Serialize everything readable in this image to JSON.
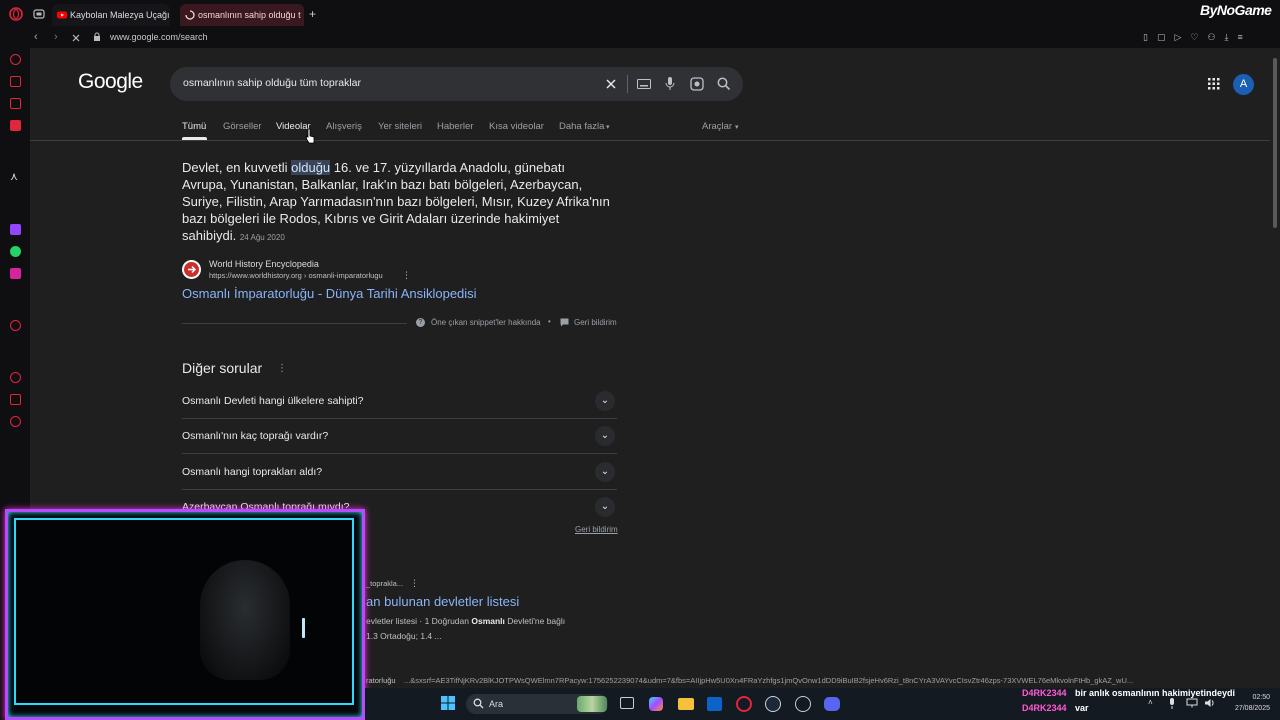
{
  "browser": {
    "tabs": [
      {
        "label": "Kaybolan Malezya Uçağı",
        "active": false
      },
      {
        "label": "osmanlının sahip olduğu t",
        "active": true
      }
    ],
    "new_tab_symbol": "+",
    "address": "www.google.com/search",
    "brand": "ByNoGame"
  },
  "google": {
    "logo": "Google",
    "query": "osmanlının sahip olduğu tüm topraklar",
    "account_initial": "A",
    "tabs": [
      "Tümü",
      "Görseller",
      "Videolar",
      "Alışveriş",
      "Yer siteleri",
      "Haberler",
      "Kısa videolar",
      "Daha fazla"
    ],
    "tools": "Araçlar",
    "featured": {
      "pre": "Devlet, en kuvvetli ",
      "highlight": "olduğu",
      "post": " 16. ve 17. yüzyıllarda Anadolu, günebatı Avrupa, Yunanistan, Balkanlar, Irak'ın bazı batı bölgeleri, Azerbaycan, Suriye, Filistin, Arap Yarımadasın'nın bazı bölgeleri, Mısır, Kuzey Afrika'nın bazı bölgeleri ile Rodos, Kıbrıs ve Girit Adaları üzerinde hakimiyet sahibiydi.",
      "date": "24 Ağu 2020",
      "source_name": "World History Encyclopedia",
      "source_url": "https://www.worldhistory.org › osmanli-imparatorlugu",
      "link": "Osmanlı İmparatorluğu - Dünya Tarihi Ansiklopedisi",
      "about": "Öne çıkan snippet'ler hakkında",
      "feedback": "Geri bildirim"
    },
    "paa": {
      "title": "Diğer sorular",
      "questions": [
        "Osmanlı Devleti hangi ülkelere sahipti?",
        "Osmanlı'nın kaç toprağı vardır?",
        "Osmanlı hangi toprakları aldı?",
        "Azerbaycan Osmanlı toprağı mıydı?"
      ],
      "feedback": "Geri bildirim"
    },
    "result2": {
      "crumb": "_toprakla...",
      "link": "an bulunan devletler listesi",
      "desc_pre": "evletler listesi · 1 Doğrudan ",
      "desc_bold": "Osmanlı",
      "desc_post": " Devleti'ne bağlı",
      "desc_line2": "1.3 Ortadoğu; 1.4 ...",
      "crumb2": "ratorluğu"
    },
    "status_url": "...&sxsrf=AE3TifNjKRv2BlKJOTPWsQWElmn7RPacyw:1756252239074&udm=7&fbs=AIIjpHw5U0Xn4FRaYzhfgs1jmQvOnw1dDD9iBuIB2fsjeHv6Rzi_t8nCYrA3VAYvcCIsvZtr46zps-73XVWEL76eMkvolnFtHb_gkAZ_wU..."
  },
  "taskbar": {
    "search_label": "Ara",
    "time": "02:50",
    "date": "27/08/2025"
  },
  "chat": [
    {
      "user": "D4RK2344",
      "message": "bir anlık osmanlının hakimiyetindeydi"
    },
    {
      "user": "D4RK2344",
      "message": "var"
    }
  ],
  "colors": {
    "page_bg": "#1f1f1f",
    "link": "#8ab4f8",
    "highlight_bg": "#394457",
    "cam_border": "#b44cff",
    "chat_user": "#ff5ad2"
  }
}
